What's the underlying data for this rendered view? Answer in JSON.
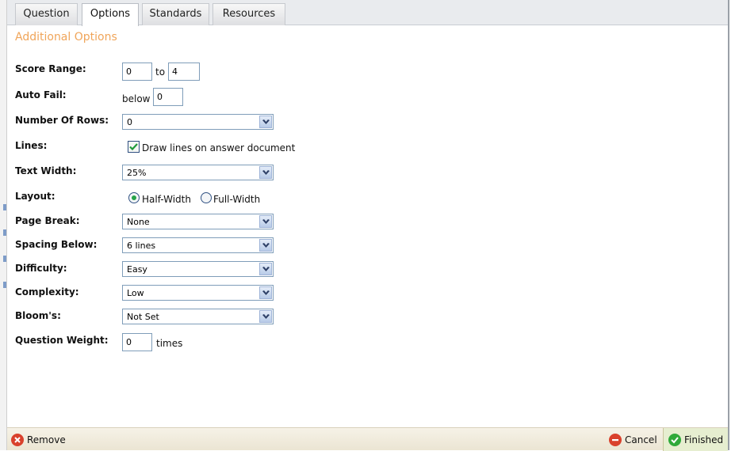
{
  "tabs": [
    "Question",
    "Options",
    "Standards",
    "Resources"
  ],
  "section_title": "Additional Options",
  "score_range": {
    "label": "Score Range:",
    "from": "0",
    "to_label": "to",
    "to": "4"
  },
  "auto_fail": {
    "label": "Auto Fail:",
    "prefix": "below",
    "value": "0"
  },
  "number_of_rows": {
    "label": "Number Of Rows:",
    "value": "0"
  },
  "lines": {
    "label": "Lines:",
    "checkbox_label": "Draw lines on answer document",
    "checked": true
  },
  "text_width": {
    "label": "Text Width:",
    "value": "25%"
  },
  "layout": {
    "label": "Layout:",
    "option1": "Half-Width",
    "option2": "Full-Width",
    "selected": "Half-Width"
  },
  "page_break": {
    "label": "Page Break:",
    "value": "None"
  },
  "spacing_below": {
    "label": "Spacing Below:",
    "value": "6 lines"
  },
  "difficulty": {
    "label": "Difficulty:",
    "value": "Easy"
  },
  "complexity": {
    "label": "Complexity:",
    "value": "Low"
  },
  "blooms": {
    "label": "Bloom's:",
    "value": "Not Set"
  },
  "question_weight": {
    "label": "Question Weight:",
    "value": "0",
    "suffix": "times"
  },
  "footer": {
    "remove": "Remove",
    "cancel": "Cancel",
    "finished": "Finished"
  },
  "colors": {
    "section_title": "#f0a55a",
    "remove": "#d9412c",
    "cancel": "#d9412c",
    "finished": "#2faa3a"
  }
}
